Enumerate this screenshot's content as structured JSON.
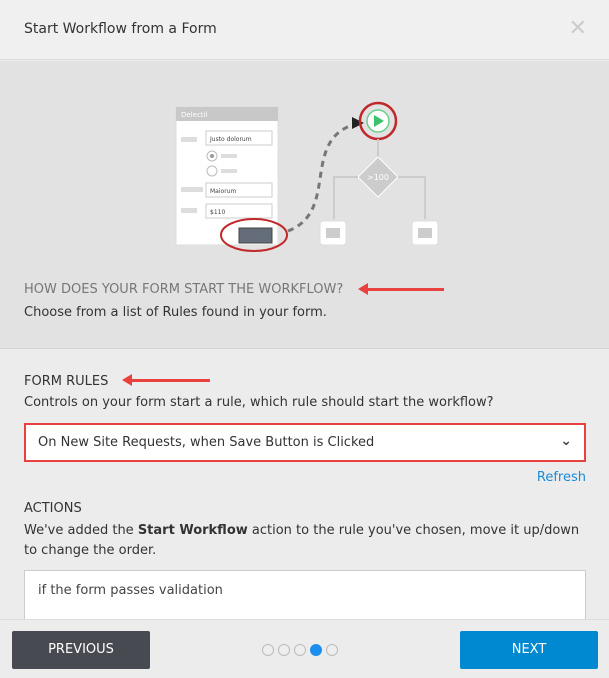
{
  "dialog": {
    "title": "Start Workflow from a Form",
    "close_icon": "close-icon"
  },
  "hero": {
    "illustration": {
      "form_title": "Delectil",
      "field1": "Justo dolorum",
      "field2": "Maiorum",
      "field3": "$110",
      "condition": ">100"
    },
    "question": "HOW DOES YOUR FORM START THE WORKFLOW?",
    "subtitle": "Choose from a list of Rules found in your form."
  },
  "form_rules": {
    "heading": "FORM RULES",
    "description": "Controls on your form start a rule, which rule should start the workflow?",
    "selected": "On New Site Requests, when Save Button is Clicked",
    "refresh": "Refresh"
  },
  "actions": {
    "heading": "ACTIONS",
    "desc_before": "We've added the ",
    "desc_bold": "Start Workflow",
    "desc_after": " action to the rule you've chosen, move it up/down to change the order.",
    "first_item": "if the form passes validation"
  },
  "footer": {
    "previous": "PREVIOUS",
    "next": "NEXT",
    "steps": 5,
    "current_step": 4
  },
  "colors": {
    "accent": "#0089d0",
    "highlight": "#e8413f",
    "active_dot": "#1b8ef0"
  }
}
